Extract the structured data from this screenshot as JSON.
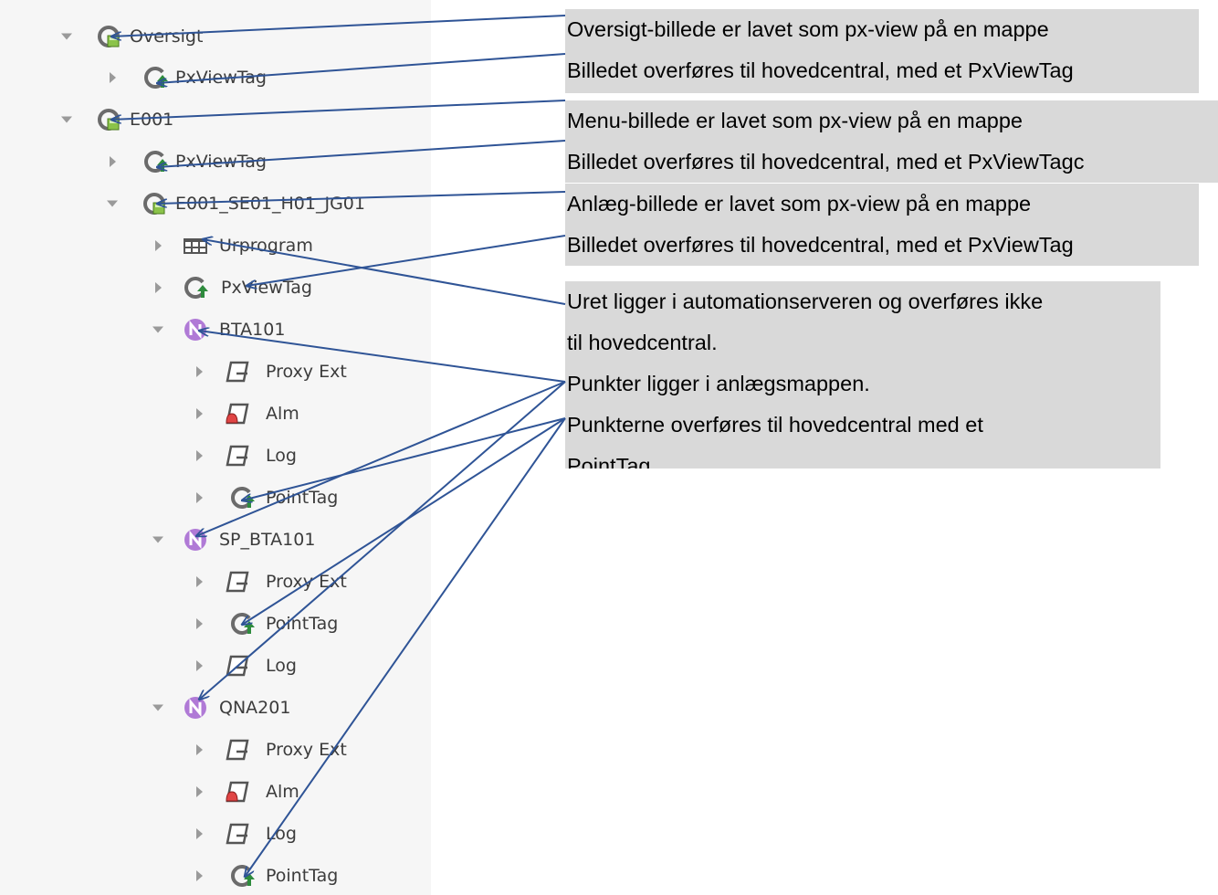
{
  "tree": [
    {
      "id": "oversigt",
      "label": "Oversigt",
      "icon": "folder-px-icon",
      "toggle": "expanded"
    },
    {
      "id": "pxviewtag-1",
      "label": "PxViewTag",
      "icon": "tag-icon",
      "toggle": "collapsed"
    },
    {
      "id": "e001",
      "label": "E001",
      "icon": "folder-px-icon",
      "toggle": "expanded"
    },
    {
      "id": "pxviewtag-2",
      "label": "PxViewTag",
      "icon": "tag-icon",
      "toggle": "collapsed"
    },
    {
      "id": "e001-se01-h01-jg01",
      "label": "E001_SE01_H01_JG01",
      "icon": "folder-px-icon",
      "toggle": "expanded"
    },
    {
      "id": "urprogram",
      "label": "Urprogram",
      "icon": "schedule-grid-icon",
      "toggle": "collapsed"
    },
    {
      "id": "pxviewtag-3",
      "label": "PxViewTag",
      "icon": "tag-icon",
      "toggle": "collapsed"
    },
    {
      "id": "bta101",
      "label": "BTA101",
      "icon": "numeric-point-icon",
      "toggle": "expanded"
    },
    {
      "id": "bta101-proxy-ext",
      "label": "Proxy Ext",
      "icon": "extension-icon",
      "toggle": "collapsed"
    },
    {
      "id": "bta101-alm",
      "label": "Alm",
      "icon": "alarm-extension-icon",
      "toggle": "collapsed"
    },
    {
      "id": "bta101-log",
      "label": "Log",
      "icon": "extension-icon",
      "toggle": "collapsed"
    },
    {
      "id": "bta101-pointtag",
      "label": "PointTag",
      "icon": "tag-icon",
      "toggle": "collapsed"
    },
    {
      "id": "sp-bta101",
      "label": "SP_BTA101",
      "icon": "numeric-point-icon",
      "toggle": "expanded"
    },
    {
      "id": "sp-bta101-proxy-ext",
      "label": "Proxy Ext",
      "icon": "extension-icon",
      "toggle": "collapsed"
    },
    {
      "id": "sp-bta101-pointtag",
      "label": "PointTag",
      "icon": "tag-icon",
      "toggle": "collapsed"
    },
    {
      "id": "sp-bta101-log",
      "label": "Log",
      "icon": "extension-icon",
      "toggle": "collapsed"
    },
    {
      "id": "qna201",
      "label": "QNA201",
      "icon": "numeric-point-icon",
      "toggle": "expanded"
    },
    {
      "id": "qna201-proxy-ext",
      "label": "Proxy Ext",
      "icon": "extension-icon",
      "toggle": "collapsed"
    },
    {
      "id": "qna201-alm",
      "label": "Alm",
      "icon": "alarm-extension-icon",
      "toggle": "collapsed"
    },
    {
      "id": "qna201-log",
      "label": "Log",
      "icon": "extension-icon",
      "toggle": "collapsed"
    },
    {
      "id": "qna201-pointtag",
      "label": "PointTag",
      "icon": "tag-icon",
      "toggle": "collapsed"
    }
  ],
  "notes": [
    {
      "id": "oversigt",
      "lines": [
        "Oversigt-billede er lavet som px-view på en mappe",
        "Billedet overføres til hovedcentral, med et PxViewTag"
      ]
    },
    {
      "id": "menu",
      "lines": [
        "Menu-billede er lavet som px-view på en mappe",
        "Billedet overføres til hovedcentral, med et PxViewTagc"
      ]
    },
    {
      "id": "anlaeg",
      "lines": [
        "Anlæg-billede er lavet som px-view på en mappe",
        "Billedet overføres til hovedcentral, med et PxViewTag"
      ]
    },
    {
      "id": "punkter",
      "lines": [
        "Uret ligger i automationserveren og overføres ikke",
        "til hovedcentral.",
        "Punkter ligger i anlægsmappen.",
        "Punkterne overføres til hovedcentral med et",
        "PointTag"
      ]
    }
  ],
  "colors": {
    "arrow": "#2f5496",
    "note_background": "#d9d9d9",
    "tree_background": "#f6f6f6",
    "numeric_point_icon": "#b07ad6",
    "alarm_icon": "#e04545",
    "tag_arrow": "#2e8b3d"
  }
}
